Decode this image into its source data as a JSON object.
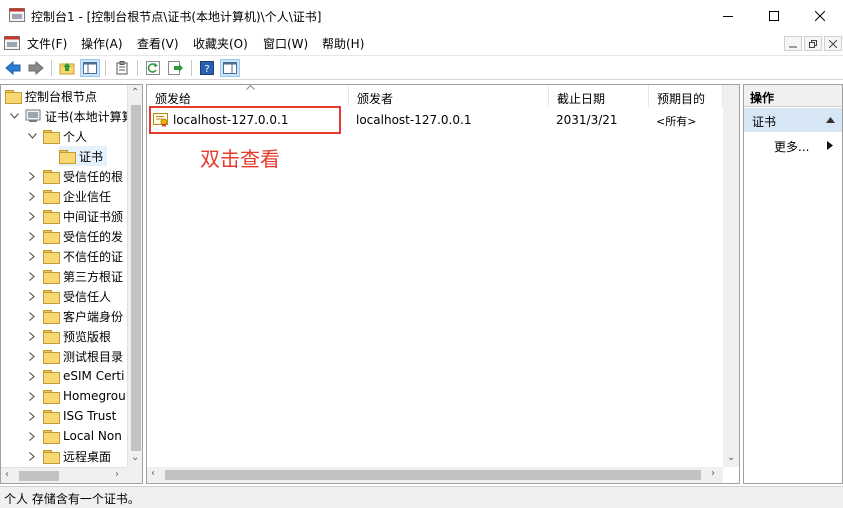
{
  "window": {
    "title": "控制台1 - [控制台根节点\\证书(本地计算机)\\个人\\证书]"
  },
  "menu": [
    {
      "label": "文件(F)"
    },
    {
      "label": "操作(A)"
    },
    {
      "label": "查看(V)"
    },
    {
      "label": "收藏夹(O)"
    },
    {
      "label": "窗口(W)"
    },
    {
      "label": "帮助(H)"
    }
  ],
  "tree": {
    "root": "控制台根节点",
    "store": "证书(本地计算算",
    "personal": "个人",
    "certificates": "证书",
    "folders": [
      "受信任的根",
      "企业信任",
      "中间证书颁",
      "受信任的发",
      "不信任的证",
      "第三方根证",
      "受信任人",
      "客户端身份",
      "预览版根",
      "测试根目录",
      "eSIM Certi",
      "Homegrou",
      "ISG Trust",
      "Local Non",
      "远程桌面"
    ]
  },
  "list": {
    "columns": [
      "颁发给",
      "颁发者",
      "截止日期",
      "预期目的"
    ],
    "rows": [
      {
        "issued_to": "localhost-127.0.0.1",
        "issued_by": "localhost-127.0.0.1",
        "expiry": "2031/3/21",
        "purpose": "<所有>"
      }
    ]
  },
  "annotation": {
    "text": "双击查看",
    "color": "#e53b2c"
  },
  "actions": {
    "header": "操作",
    "section": "证书",
    "more": "更多..."
  },
  "status": {
    "text": "个人 存储含有一个证书。"
  },
  "colors": {
    "selection": "#e5f1fb",
    "action_section": "#d7e6f5",
    "accent": "#0078d7"
  }
}
